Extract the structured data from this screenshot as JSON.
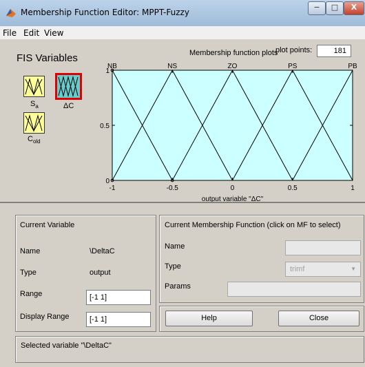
{
  "window": {
    "title": "Membership Function Editor: MPPT-Fuzzy",
    "minimize": "−",
    "maximize": "□",
    "close": "X"
  },
  "menu": [
    "File",
    "Edit",
    "View"
  ],
  "fis_variables": {
    "heading": "FIS Variables",
    "inputs": [
      {
        "label": "S",
        "sub": "a"
      },
      {
        "label": "C",
        "sub": "old"
      }
    ],
    "output": {
      "label": "ΔC"
    }
  },
  "plot": {
    "header": "Membership function plots",
    "plot_points_label": "plot points:",
    "plot_points_value": "181"
  },
  "chart_data": {
    "type": "line",
    "xlim": [
      -1,
      1
    ],
    "ylim": [
      0,
      1
    ],
    "xlabel": "output variable \"ΔC\"",
    "xticks": [
      "-1",
      "-0.5",
      "0",
      "0.5",
      "1"
    ],
    "yticks": [
      "0",
      "0.5",
      "1"
    ],
    "series": [
      {
        "name": "NB",
        "x": [
          -1.5,
          -1,
          -0.5
        ],
        "y": [
          0,
          1,
          0
        ]
      },
      {
        "name": "NS",
        "x": [
          -1,
          -0.5,
          0
        ],
        "y": [
          0,
          1,
          0
        ]
      },
      {
        "name": "ZO",
        "x": [
          -0.5,
          0,
          0.5
        ],
        "y": [
          0,
          1,
          0
        ]
      },
      {
        "name": "PS",
        "x": [
          0,
          0.5,
          1
        ],
        "y": [
          0,
          1,
          0
        ]
      },
      {
        "name": "PB",
        "x": [
          0.5,
          1,
          1.5
        ],
        "y": [
          0,
          1,
          0
        ]
      }
    ],
    "background": "#ccffff"
  },
  "current_variable": {
    "title": "Current Variable",
    "name_label": "Name",
    "name_value": "\\DeltaC",
    "type_label": "Type",
    "type_value": "output",
    "range_label": "Range",
    "range_value": "[-1 1]",
    "display_range_label": "Display Range",
    "display_range_value": "[-1 1]"
  },
  "current_mf": {
    "title": "Current Membership Function (click on MF to select)",
    "name_label": "Name",
    "name_value": "",
    "type_label": "Type",
    "type_value": "trimf",
    "params_label": "Params",
    "params_value": ""
  },
  "buttons": {
    "help": "Help",
    "close": "Close"
  },
  "status": "Selected variable \"\\DeltaC\""
}
